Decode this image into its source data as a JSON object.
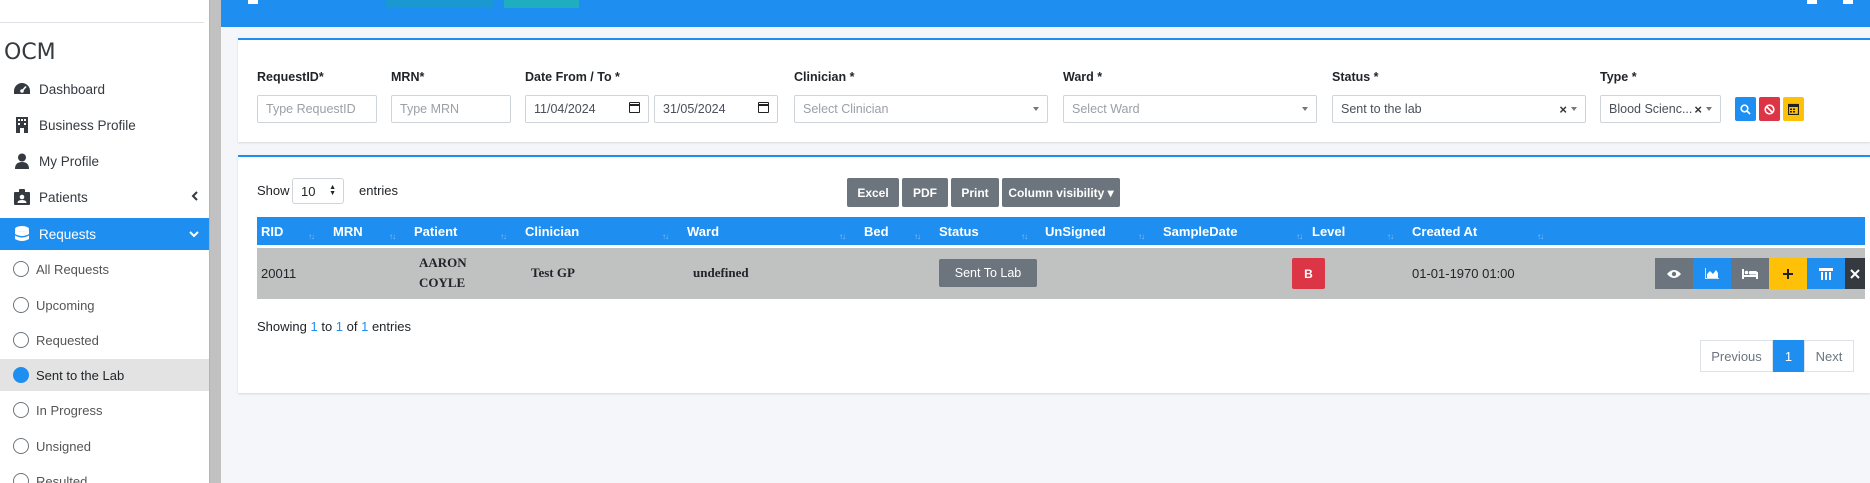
{
  "brand": "OCM",
  "sidebar": {
    "items": [
      {
        "label": "Dashboard",
        "icon": "tachometer-icon"
      },
      {
        "label": "Business Profile",
        "icon": "building-icon"
      },
      {
        "label": "My Profile",
        "icon": "user-icon"
      },
      {
        "label": "Patients",
        "icon": "patient-icon"
      },
      {
        "label": "Requests",
        "icon": "database-icon"
      }
    ],
    "sub_items": [
      {
        "label": "All Requests"
      },
      {
        "label": "Upcoming"
      },
      {
        "label": "Requested"
      },
      {
        "label": "Sent to the Lab"
      },
      {
        "label": "In Progress"
      },
      {
        "label": "Unsigned"
      },
      {
        "label": "Resulted"
      }
    ],
    "active_item": "Requests",
    "current_sub_item": "Sent to the Lab"
  },
  "filters": {
    "request_id": {
      "label": "RequestID*",
      "placeholder": "Type RequestID"
    },
    "mrn": {
      "label": "MRN*",
      "placeholder": "Type MRN"
    },
    "date": {
      "label": "Date From / To *",
      "from": "11/04/2024",
      "to": "31/05/2024"
    },
    "clinician": {
      "label": "Clinician *",
      "placeholder": "Select Clinician"
    },
    "ward": {
      "label": "Ward *",
      "placeholder": "Select Ward"
    },
    "status": {
      "label": "Status *",
      "value": "Sent to the lab",
      "clear": "×"
    },
    "type": {
      "label": "Type *",
      "value": "Blood Scienc...",
      "clear": "×"
    }
  },
  "table_controls": {
    "show_label": "Show",
    "page_size": "10",
    "entries_label": "entries",
    "buttons": [
      "Excel",
      "PDF",
      "Print",
      "Column visibility ▾"
    ]
  },
  "table": {
    "columns": [
      "RID",
      "MRN",
      "Patient",
      "Clinician",
      "Ward",
      "Bed",
      "Status",
      "UnSigned",
      "SampleDate",
      "Level",
      "Created At"
    ],
    "row": {
      "rid": "20011",
      "mrn": "",
      "patient_line1": "AARON",
      "patient_line2": "COYLE",
      "clinician": "Test GP",
      "ward": "undefined",
      "bed": "",
      "status": "Sent To Lab",
      "unsigned": "",
      "sample_date": "",
      "level": "B",
      "created_at": "01-01-1970 01:00"
    }
  },
  "footer": {
    "showing_prefix": "Showing ",
    "from": "1",
    "to_word": " to ",
    "to": "1",
    "of_word": " of ",
    "total": "1",
    "suffix": " entries"
  },
  "pagination": {
    "previous": "Previous",
    "current": "1",
    "next": "Next"
  },
  "colors": {
    "primary": "#1e8ff0",
    "secondary": "#6c757d",
    "danger": "#dc3545",
    "warning": "#ffc107",
    "dark": "#343a40",
    "row_bg": "#c0c1c1"
  }
}
